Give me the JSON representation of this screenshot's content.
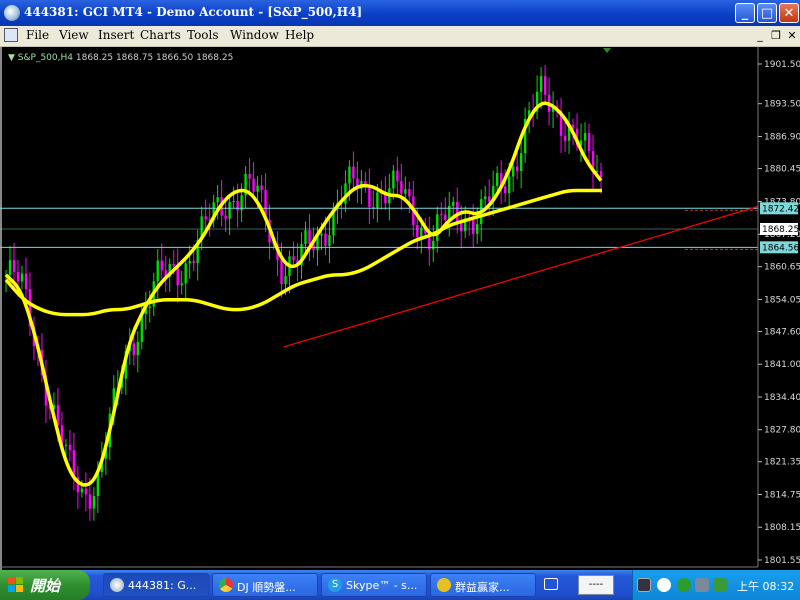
{
  "window": {
    "title": "444381: GCI MT4 - Demo Account - [S&P_500,H4]",
    "buttons": {
      "minimize": "_",
      "maximize": "□",
      "close": "✕"
    }
  },
  "menu": {
    "items": [
      "File",
      "View",
      "Insert",
      "Charts",
      "Tools",
      "Window",
      "Help"
    ],
    "controls": [
      "_",
      "❐",
      "✕"
    ]
  },
  "chart": {
    "symbol": "S&P_500,H4",
    "ohlc": "1868.25 1868.75 1866.50 1868.25",
    "colors": {
      "background": "#000000",
      "bull": "#00dd00",
      "bear": "#ff00ff",
      "ma": "#ffff00",
      "trend": "#ff0000",
      "hline": "#7fd8d8"
    },
    "price_labels": {
      "level_a": "1872.42",
      "current": "1868.25",
      "level_b": "1864.56"
    }
  },
  "chart_data": {
    "type": "line",
    "ylim": [
      1800,
      1903
    ],
    "yticks": [
      1901.5,
      1893.5,
      1886.9,
      1880.45,
      1873.8,
      1867.2,
      1860.65,
      1854.05,
      1847.6,
      1841.0,
      1834.4,
      1827.8,
      1821.35,
      1814.75,
      1808.15,
      1801.55
    ],
    "hlines": [
      1872.42,
      1868.25,
      1864.56
    ],
    "trendline": [
      [
        0,
        1844.5
      ],
      [
        1,
        1872.8
      ]
    ],
    "series": [
      {
        "values": [
          1859,
          1856,
          1846,
          1832,
          1820,
          1816,
          1818,
          1830,
          1845,
          1852,
          1857,
          1860,
          1863,
          1867,
          1873,
          1876,
          1876,
          1871,
          1862,
          1860,
          1865,
          1870,
          1874,
          1877,
          1877,
          1875,
          1875,
          1871,
          1866,
          1870,
          1872,
          1871,
          1874,
          1880,
          1889,
          1894,
          1893,
          1889,
          1882,
          1878
        ]
      },
      {
        "values": [
          1858,
          1854,
          1852,
          1851,
          1851,
          1851,
          1852,
          1852,
          1853,
          1854,
          1854,
          1854,
          1853,
          1852,
          1852,
          1853,
          1855,
          1857,
          1858,
          1859,
          1859,
          1860,
          1862,
          1864,
          1866,
          1867,
          1869,
          1870,
          1871,
          1872,
          1873,
          1874,
          1875,
          1876,
          1876,
          1876
        ]
      }
    ]
  },
  "taskbar": {
    "start_label": "開始",
    "tasks": [
      "444381: G...",
      "DJ 順勢盤...",
      "Skype™ - s...",
      "群益贏家..."
    ],
    "lang": "----",
    "clock": "上午 08:32"
  }
}
